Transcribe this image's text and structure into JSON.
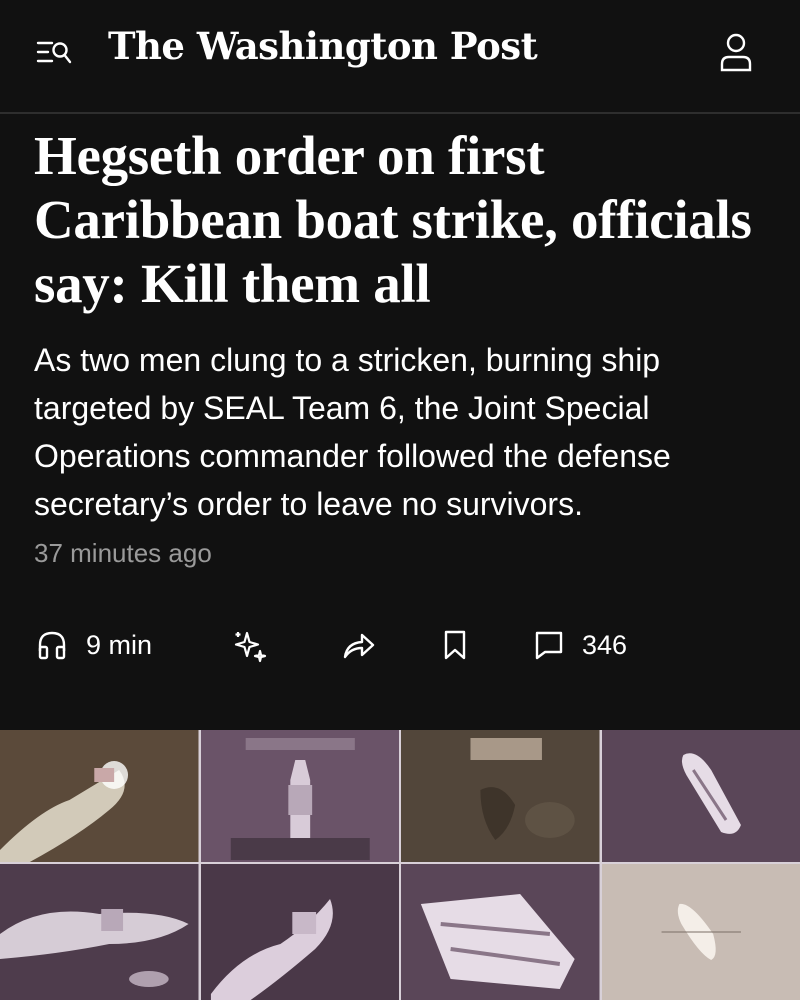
{
  "header": {
    "masthead": "The Washington Post",
    "menu_icon": "menu-search-icon",
    "account_icon": "user-icon"
  },
  "article": {
    "headline": "Hegseth order on first Caribbean boat strike, officials say: Kill them all",
    "dek": "As two men clung to a stricken, burning ship targeted by SEAL Team 6, the Joint Special Operations commander followed the defense secretary’s order to leave no survivors.",
    "timestamp": "37 minutes ago"
  },
  "actions": {
    "listen": {
      "icon": "headphones-icon",
      "label": "9 min"
    },
    "gift": {
      "icon": "sparkle-gift-icon"
    },
    "share": {
      "icon": "share-icon"
    },
    "save": {
      "icon": "bookmark-icon"
    },
    "comments": {
      "icon": "comment-icon",
      "count": "346"
    }
  },
  "media": {
    "description_icons": [
      "boat-strike-thumbnail"
    ],
    "tile_count": 8
  },
  "colors": {
    "background": "#111111",
    "text": "#ffffff",
    "muted_text": "#9a9a9a",
    "tile_purple": "#6a5368",
    "tile_brown": "#5b4a3a"
  }
}
